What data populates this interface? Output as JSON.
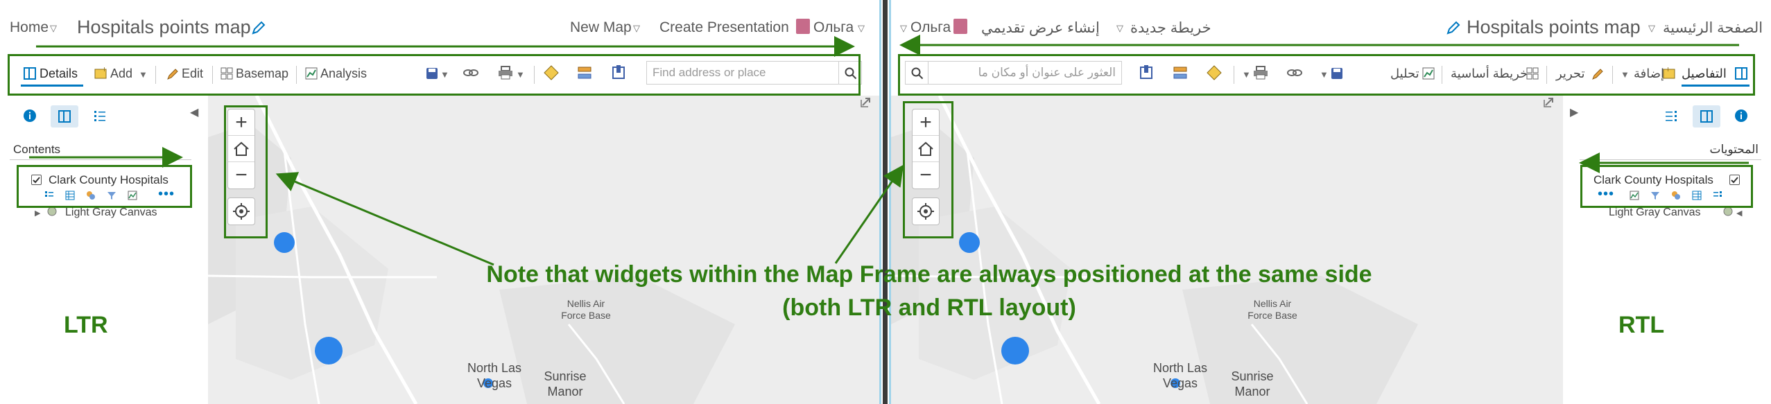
{
  "ltr": {
    "header": {
      "home": "Home",
      "map_title": "Hospitals points map",
      "new_map": "New Map",
      "create_presentation": "Create Presentation",
      "user_name": "Ольга"
    },
    "toolbar": {
      "details": "Details",
      "add": "Add",
      "edit": "Edit",
      "basemap": "Basemap",
      "analysis": "Analysis",
      "search_placeholder": "Find address or place"
    },
    "sidebar": {
      "contents_title": "Contents",
      "layers": [
        "Clark County Hospitals",
        "Light Gray Canvas"
      ]
    },
    "direction_label": "LTR"
  },
  "rtl": {
    "header": {
      "home": "الصفحة الرئيسية",
      "map_title": "Hospitals points map",
      "new_map": "خريطة جديدة",
      "create_presentation": "إنشاء عرض تقديمي",
      "user_name": "Ольга"
    },
    "toolbar": {
      "details": "التفاصيل",
      "add": "إضافة",
      "edit": "تحرير",
      "basemap": "خريطة أساسية",
      "analysis": "تحليل",
      "search_placeholder": "العثور على عنوان أو مكان ما"
    },
    "sidebar": {
      "contents_title": "المحتويات",
      "layers": [
        "Clark County Hospitals",
        "Light Gray Canvas"
      ]
    },
    "direction_label": "RTL"
  },
  "map_labels": {
    "nellis_air_force_base": [
      "Nellis Air",
      "Force Base"
    ],
    "north_las_vegas": [
      "North Las",
      "Vegas"
    ],
    "sunrise_manor": [
      "Sunrise",
      "Manor"
    ]
  },
  "annotation": {
    "note_line1": "Note that widgets within the Map Frame are always positioned at the same side",
    "note_line2": "(both LTR and RTL layout)"
  },
  "colors": {
    "annotation_green": "#2f7d12",
    "accent_blue": "#0079c1",
    "point_blue": "#2d85ea",
    "map_background": "#ececec"
  },
  "icons": {
    "edit_title": "pencil-icon",
    "zoom_in": "plus-icon",
    "home": "home-icon",
    "zoom_out": "minus-icon",
    "locate": "locate-icon",
    "collapse": "chevron-left-icon",
    "expand_frame": "expand-arrow-icon"
  }
}
